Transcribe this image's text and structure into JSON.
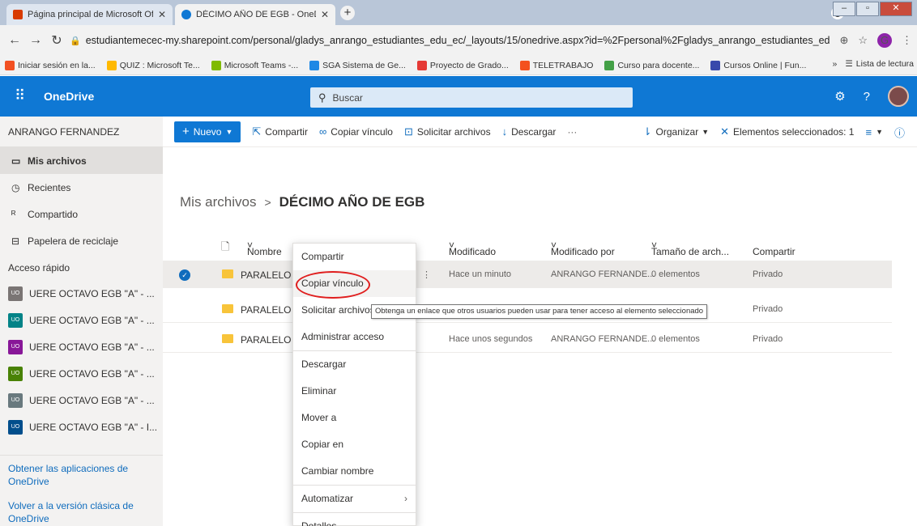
{
  "browser": {
    "tabs": [
      {
        "title": "Página principal de Microsoft Off",
        "icon": "office-icon",
        "color": "#d83b01"
      },
      {
        "title": "DÉCIMO AÑO DE EGB - OneDrive",
        "icon": "onedrive-icon",
        "color": "#0f78d4"
      }
    ],
    "url": "estudiantemecec-my.sharepoint.com/personal/gladys_anrango_estudiantes_edu_ec/_layouts/15/onedrive.aspx?id=%2Fpersonal%2Fgladys_anrango_estudiantes_edu_ec%2F...",
    "profile_initial": "G",
    "bookmarks": [
      {
        "label": "Iniciar sesión en la...",
        "color": "#f25022"
      },
      {
        "label": "QUIZ : Microsoft Te...",
        "color": "#ffb900"
      },
      {
        "label": "Microsoft Teams -...",
        "color": "#ffb900"
      },
      {
        "label": "SGA Sistema de Ge...",
        "color": "#1e88e5"
      },
      {
        "label": "Proyecto de Grado...",
        "color": "#e53935"
      },
      {
        "label": "TELETRABAJO",
        "color": "#f4511e"
      },
      {
        "label": "Curso para docente...",
        "color": "#43a047"
      },
      {
        "label": "Cursos Online | Fun...",
        "color": "#3949ab"
      }
    ],
    "reading_list": "Lista de lectura"
  },
  "header": {
    "brand": "OneDrive",
    "search_placeholder": "Buscar"
  },
  "sidebar": {
    "account": "ANRANGO FERNANDEZ",
    "items": [
      {
        "label": "Mis archivos",
        "icon": "folder-icon",
        "glyph": "▭"
      },
      {
        "label": "Recientes",
        "icon": "clock-icon",
        "glyph": "◷"
      },
      {
        "label": "Compartido",
        "icon": "people-icon",
        "glyph": "ℛ"
      },
      {
        "label": "Papelera de reciclaje",
        "icon": "trash-icon",
        "glyph": "🗑"
      }
    ],
    "quick_access_title": "Acceso rápido",
    "quick_access": [
      {
        "label": "UERE OCTAVO EGB \"A\" - ...",
        "color": "#7a7574"
      },
      {
        "label": "UERE OCTAVO EGB \"A\" - ...",
        "color": "#038387"
      },
      {
        "label": "UERE OCTAVO EGB \"A\" - ...",
        "color": "#881798"
      },
      {
        "label": "UERE OCTAVO EGB \"A\" - ...",
        "color": "#498205"
      },
      {
        "label": "UERE OCTAVO EGB \"A\" - ...",
        "color": "#69797e"
      },
      {
        "label": "UERE OCTAVO EGB \"A\" - I...",
        "color": "#004e8c"
      }
    ],
    "get_apps": "Obtener las aplicaciones de OneDrive",
    "classic": "Volver a la versión clásica de OneDrive"
  },
  "commandbar": {
    "new": "Nuevo",
    "share": "Compartir",
    "copy_link": "Copiar vínculo",
    "request_files": "Solicitar archivos",
    "download": "Descargar",
    "more": "···",
    "sort": "Organizar",
    "selected": "Elementos seleccionados: 1"
  },
  "breadcrumb": {
    "root": "Mis archivos",
    "current": "DÉCIMO AÑO DE EGB"
  },
  "columns": [
    "Nombre",
    "Modificado",
    "Modificado por",
    "Tamaño de arch...",
    "Compartir"
  ],
  "rows": [
    {
      "name": "PARALELO",
      "modified": "Hace un minuto",
      "by": "ANRANGO FERNANDE...",
      "size": "0 elementos",
      "share": "Privado"
    },
    {
      "name": "PARALELO I",
      "modified": "",
      "by": "",
      "size": "",
      "share": "Privado"
    },
    {
      "name": "PARALELO",
      "modified": "Hace unos segundos",
      "by": "ANRANGO FERNANDE...",
      "size": "0 elementos",
      "share": "Privado"
    }
  ],
  "context_menu": {
    "items": [
      "Compartir",
      "Copiar vínculo",
      "Solicitar archivos",
      "Administrar acceso",
      "Descargar",
      "Eliminar",
      "Mover a",
      "Copiar en",
      "Cambiar nombre",
      "Automatizar",
      "Detalles"
    ]
  },
  "tooltip": "Obtenga un enlace que otros usuarios pueden usar para tener acceso al elemento seleccionado"
}
